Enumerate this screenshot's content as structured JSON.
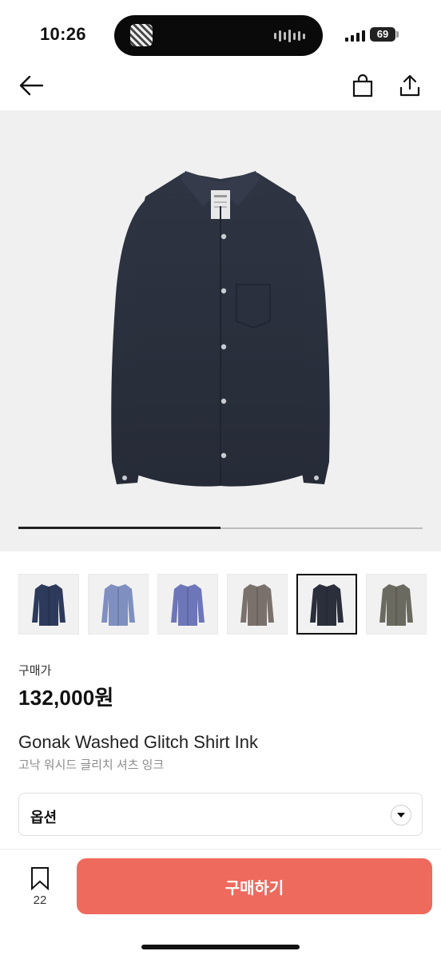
{
  "status_bar": {
    "time": "10:26",
    "battery": "69"
  },
  "nav": {
    "back_icon": "arrow-left-icon",
    "bag_icon": "shopping-bag-icon",
    "share_icon": "share-icon"
  },
  "product": {
    "image_progress": 0.5,
    "thumbnails": [
      {
        "name": "navy",
        "color": "#2d3a5c"
      },
      {
        "name": "light-blue",
        "color": "#7f8fc0"
      },
      {
        "name": "blue-stripe",
        "color": "#6d76b8"
      },
      {
        "name": "grey-brown",
        "color": "#7a716d"
      },
      {
        "name": "ink",
        "color": "#2b2f3b",
        "selected": true
      },
      {
        "name": "olive-grey",
        "color": "#6b6a60"
      }
    ],
    "price_label": "구매가",
    "price": "132,000원",
    "name_en": "Gonak Washed Glitch Shirt Ink",
    "name_ko": "고낙 워시드 글리치 셔츠 잉크",
    "option_label": "옵션"
  },
  "footer": {
    "like_count": "22",
    "buy_label": "구매하기",
    "buy_color": "#ee6a5c"
  }
}
